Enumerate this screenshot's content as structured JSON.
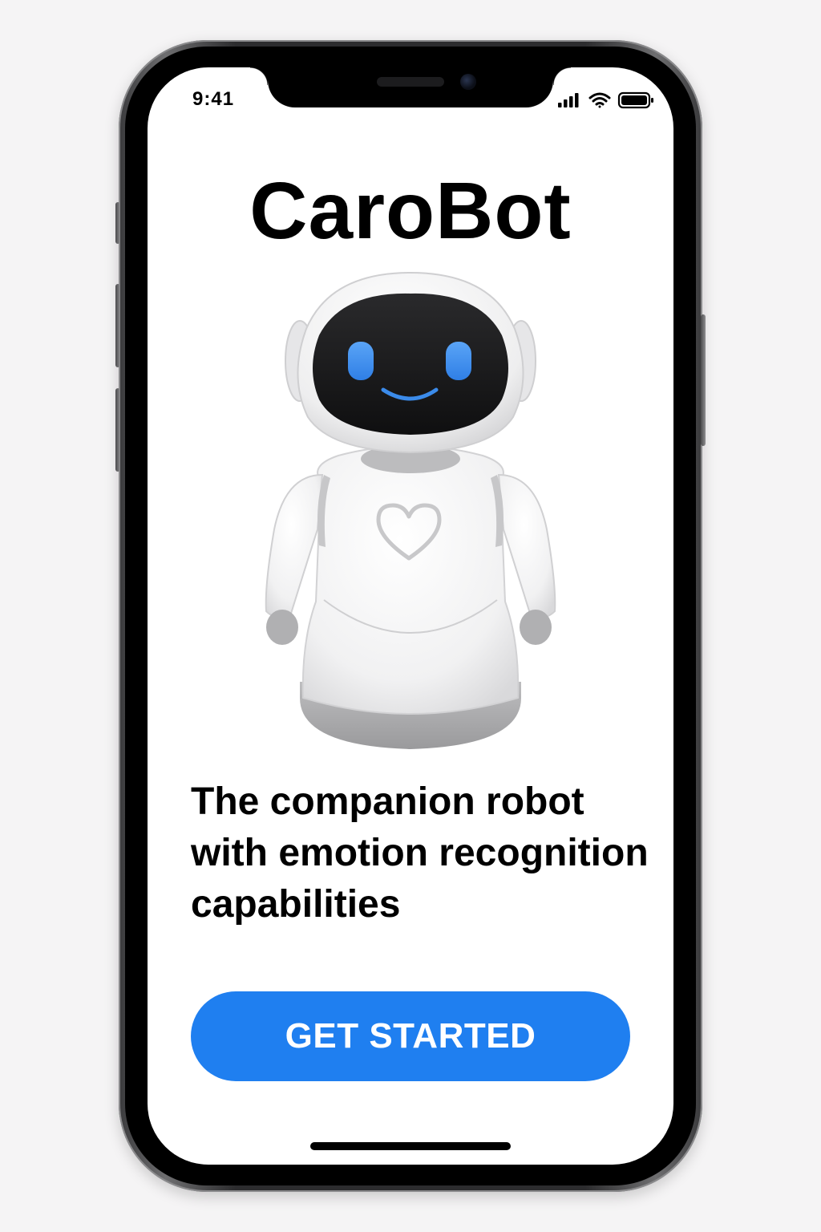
{
  "status_bar": {
    "time": "9:41",
    "icons": [
      "signal-icon",
      "wifi-icon",
      "battery-icon"
    ]
  },
  "app": {
    "title": "CaroBot",
    "tagline": "The companion robot with emotion recognition capabilities",
    "cta_label": "GET STARTED"
  },
  "illustration": {
    "subject": "robot-illustration",
    "emblem": "heart-icon"
  },
  "colors": {
    "accent": "#1f7ff0",
    "robot_eyes": "#3b8bea",
    "text": "#000000",
    "screen_background": "#ffffff"
  }
}
